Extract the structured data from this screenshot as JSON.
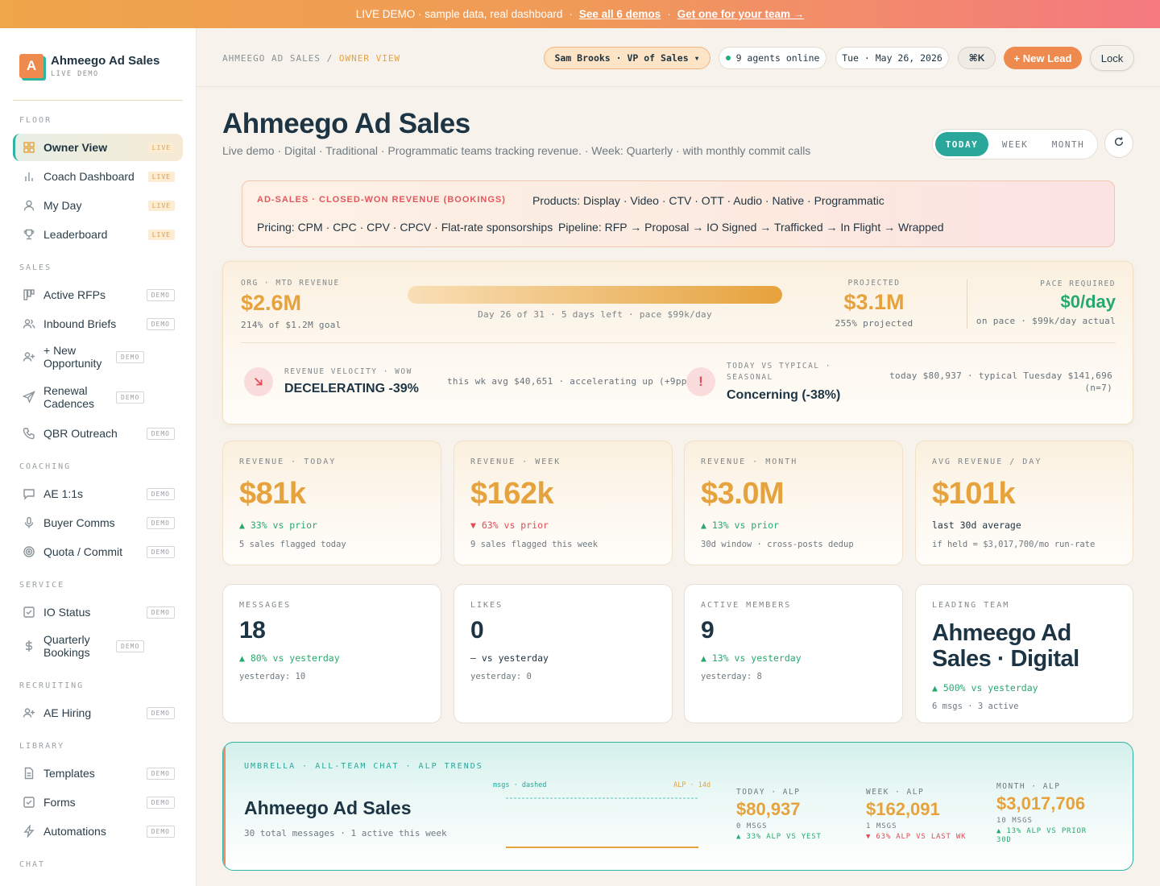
{
  "banner": {
    "text": "LIVE DEMO · sample data, real dashboard",
    "sep": "·",
    "link1": "See all 6 demos",
    "link2": "Get one for your team →"
  },
  "brand": {
    "logo_letter": "A",
    "name": "Ahmeego Ad Sales",
    "sub": "LIVE DEMO"
  },
  "nav": {
    "sections": {
      "floor": "FLOOR",
      "sales": "SALES",
      "coaching": "COACHING",
      "service": "SERVICE",
      "recruiting": "RECRUITING",
      "library": "LIBRARY",
      "chat": "CHAT"
    },
    "items": [
      {
        "label": "Owner View",
        "tag": "LIVE",
        "icon": "grid-icon"
      },
      {
        "label": "Coach Dashboard",
        "tag": "LIVE",
        "icon": "bar-chart-icon"
      },
      {
        "label": "My Day",
        "tag": "LIVE",
        "icon": "user-icon"
      },
      {
        "label": "Leaderboard",
        "tag": "LIVE",
        "icon": "trophy-icon"
      },
      {
        "label": "Active RFPs",
        "tag": "DEMO",
        "icon": "kanban-icon"
      },
      {
        "label": "Inbound Briefs",
        "tag": "DEMO",
        "icon": "users-icon"
      },
      {
        "label": "+ New Opportunity",
        "tag": "DEMO",
        "icon": "user-plus-icon"
      },
      {
        "label": "Renewal Cadences",
        "tag": "DEMO",
        "icon": "send-icon"
      },
      {
        "label": "QBR Outreach",
        "tag": "DEMO",
        "icon": "phone-icon"
      },
      {
        "label": "AE 1:1s",
        "tag": "DEMO",
        "icon": "message-icon"
      },
      {
        "label": "Buyer Comms",
        "tag": "DEMO",
        "icon": "mic-icon"
      },
      {
        "label": "Quota / Commit",
        "tag": "DEMO",
        "icon": "target-icon"
      },
      {
        "label": "IO Status",
        "tag": "DEMO",
        "icon": "check-square-icon"
      },
      {
        "label": "Quarterly Bookings",
        "tag": "DEMO",
        "icon": "dollar-icon"
      },
      {
        "label": "AE Hiring",
        "tag": "DEMO",
        "icon": "user-plus-icon"
      },
      {
        "label": "Templates",
        "tag": "DEMO",
        "icon": "file-icon"
      },
      {
        "label": "Forms",
        "tag": "DEMO",
        "icon": "check-square-icon"
      },
      {
        "label": "Automations",
        "tag": "DEMO",
        "icon": "zap-icon"
      }
    ]
  },
  "topbar": {
    "crumb_root": "AHMEEGO AD SALES",
    "crumb_sep": "/",
    "crumb_current": "OWNER VIEW",
    "user": "Sam Brooks · VP of Sales ▾",
    "agents": "9 agents online",
    "date": "Tue · May 26, 2026",
    "cmd": "⌘K",
    "new_lead": "+ New Lead",
    "lock": "Lock"
  },
  "header": {
    "title": "Ahmeego Ad Sales",
    "subtitle": "Live demo · Digital · Traditional · Programmatic teams tracking revenue. · Week: Quarterly · with monthly commit calls",
    "ranges": [
      "TODAY",
      "WEEK",
      "MONTH"
    ],
    "active_range": "TODAY"
  },
  "info": {
    "kicker": "AD-SALES · CLOSED-WON REVENUE (BOOKINGS)",
    "products": "Products: Display · Video · CTV · OTT · Audio · Native · Programmatic",
    "pricing": "Pricing: CPM · CPC · CPV · CPCV · Flat-rate sponsorships",
    "pipeline": "Pipeline: RFP → Proposal → IO Signed → Trafficked → In Flight → Wrapped"
  },
  "mtd": {
    "caption": "ORG · MTD REVENUE",
    "value": "$2.6M",
    "goal": "214% of $1.2M goal",
    "progress_fraction": 1.0,
    "progress_text": "Day 26 of 31 · 5 days left · pace $99k/day",
    "projected_caption": "PROJECTED",
    "projected_value": "$3.1M",
    "projected_sub": "255% projected",
    "pace_caption": "PACE REQUIRED",
    "pace_value": "$0/day",
    "pace_sub": "on pace · $99k/day actual",
    "velocity_caption": "REVENUE VELOCITY · WOW",
    "velocity_value": "DECELERATING -39%",
    "velocity_detail": "this wk avg $40,651 · accelerating up (+9pp)",
    "typical_caption_1": "TODAY VS TYPICAL ·",
    "typical_caption_2": "SEASONAL",
    "typical_value": "Concerning (-38%)",
    "typical_detail_1": "today $80,937 · typical Tuesday $141,696",
    "typical_detail_2": "(n=7)",
    "alert_glyph": "!"
  },
  "revenue_cards": [
    {
      "caption": "REVENUE · TODAY",
      "value": "$81k",
      "delta": "▲ 33% vs prior",
      "dir": "up",
      "foot": "5 sales flagged today"
    },
    {
      "caption": "REVENUE · WEEK",
      "value": "$162k",
      "delta": "▼ 63% vs prior",
      "dir": "down",
      "foot": "9 sales flagged this week"
    },
    {
      "caption": "REVENUE · MONTH",
      "value": "$3.0M",
      "delta": "▲ 13% vs prior",
      "dir": "up",
      "foot": "30d window · cross-posts dedup"
    },
    {
      "caption": "AVG REVENUE / DAY",
      "value": "$101k",
      "delta": "last 30d average",
      "dir": "neutral",
      "foot": "if held = $3,017,700/mo run-rate"
    }
  ],
  "activity_cards": [
    {
      "caption": "MESSAGES",
      "value": "18",
      "delta": "▲ 80% vs yesterday",
      "dir": "up",
      "foot": "yesterday: 10"
    },
    {
      "caption": "LIKES",
      "value": "0",
      "delta": "— vs yesterday",
      "dir": "neutral",
      "foot": "yesterday: 0"
    },
    {
      "caption": "ACTIVE MEMBERS",
      "value": "9",
      "delta": "▲ 13% vs yesterday",
      "dir": "up",
      "foot": "yesterday: 8"
    },
    {
      "caption": "LEADING TEAM",
      "value_1": "Ahmeego Ad",
      "value_2": "Sales · Digital",
      "delta": "▲ 500% vs yesterday",
      "dir": "up",
      "foot": "6 msgs · 3 active"
    }
  ],
  "umbrella": {
    "kicker": "UMBRELLA · ALL-TEAM CHAT · ALP TRENDS",
    "title": "Ahmeego Ad Sales",
    "sub": "30 total messages · 1 active this week",
    "legend_left": "msgs · dashed",
    "legend_right": "ALP · 14d",
    "stats": [
      {
        "caption": "TODAY · ALP",
        "value": "$80,937",
        "msgs": "0 MSGS",
        "delta": "▲ 33% ALP VS YEST",
        "dir": "up"
      },
      {
        "caption": "WEEK · ALP",
        "value": "$162,091",
        "msgs": "1 MSGS",
        "delta": "▼ 63% ALP VS LAST WK",
        "dir": "down"
      },
      {
        "caption": "MONTH · ALP",
        "value": "$3,017,706",
        "msgs": "10 MSGS",
        "delta_1": "▲ 13% ALP VS PRIOR",
        "delta_2": "30D",
        "dir": "up"
      }
    ]
  },
  "colors": {
    "accent": "#e6a23c",
    "teal": "#2aa79a",
    "up": "#27a96d",
    "down": "#e24b57",
    "brand": "#ef8a4f"
  }
}
